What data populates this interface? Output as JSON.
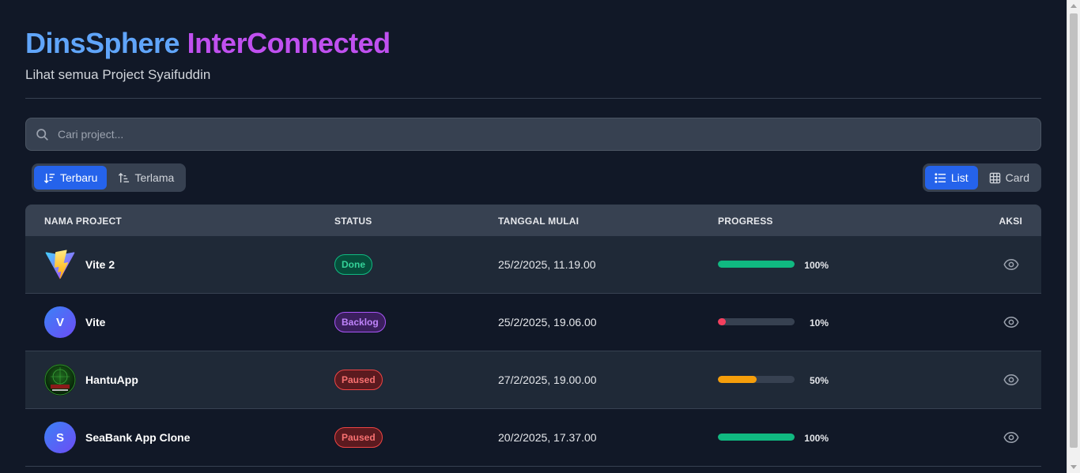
{
  "header": {
    "title_part1": "DinsSphere",
    "title_part2": "InterConnected",
    "subtitle": "Lihat semua Project Syaifuddin"
  },
  "search": {
    "placeholder": "Cari project...",
    "value": ""
  },
  "sort": {
    "newest_label": "Terbaru",
    "oldest_label": "Terlama",
    "active": "Terbaru"
  },
  "view": {
    "list_label": "List",
    "card_label": "Card",
    "active": "List"
  },
  "table": {
    "headers": [
      "NAMA PROJECT",
      "STATUS",
      "TANGGAL MULAI",
      "PROGRESS",
      "AKSI"
    ],
    "rows": [
      {
        "name": "Vite 2",
        "avatar": "vite-logo",
        "status": "Done",
        "status_kind": "done",
        "start": "25/2/2025, 11.19.00",
        "progress": 100,
        "progress_label": "100%",
        "bar_color": "#10b981"
      },
      {
        "name": "Vite",
        "avatar": "V",
        "status": "Backlog",
        "status_kind": "backlog",
        "start": "25/2/2025, 19.06.00",
        "progress": 10,
        "progress_label": "10%",
        "bar_color": "#f43f5e"
      },
      {
        "name": "HantuApp",
        "avatar": "hantu-logo",
        "status": "Paused",
        "status_kind": "paused",
        "start": "27/2/2025, 19.00.00",
        "progress": 50,
        "progress_label": "50%",
        "bar_color": "#f59e0b"
      },
      {
        "name": "SeaBank App Clone",
        "avatar": "S",
        "status": "Paused",
        "status_kind": "paused",
        "start": "20/2/2025, 17.37.00",
        "progress": 100,
        "progress_label": "100%",
        "bar_color": "#10b981"
      }
    ]
  },
  "colors": {
    "background": "#111827",
    "accent": "#2563eb",
    "title_gradient": [
      "#60a5fa",
      "#c050f0",
      "#ec4899"
    ]
  }
}
